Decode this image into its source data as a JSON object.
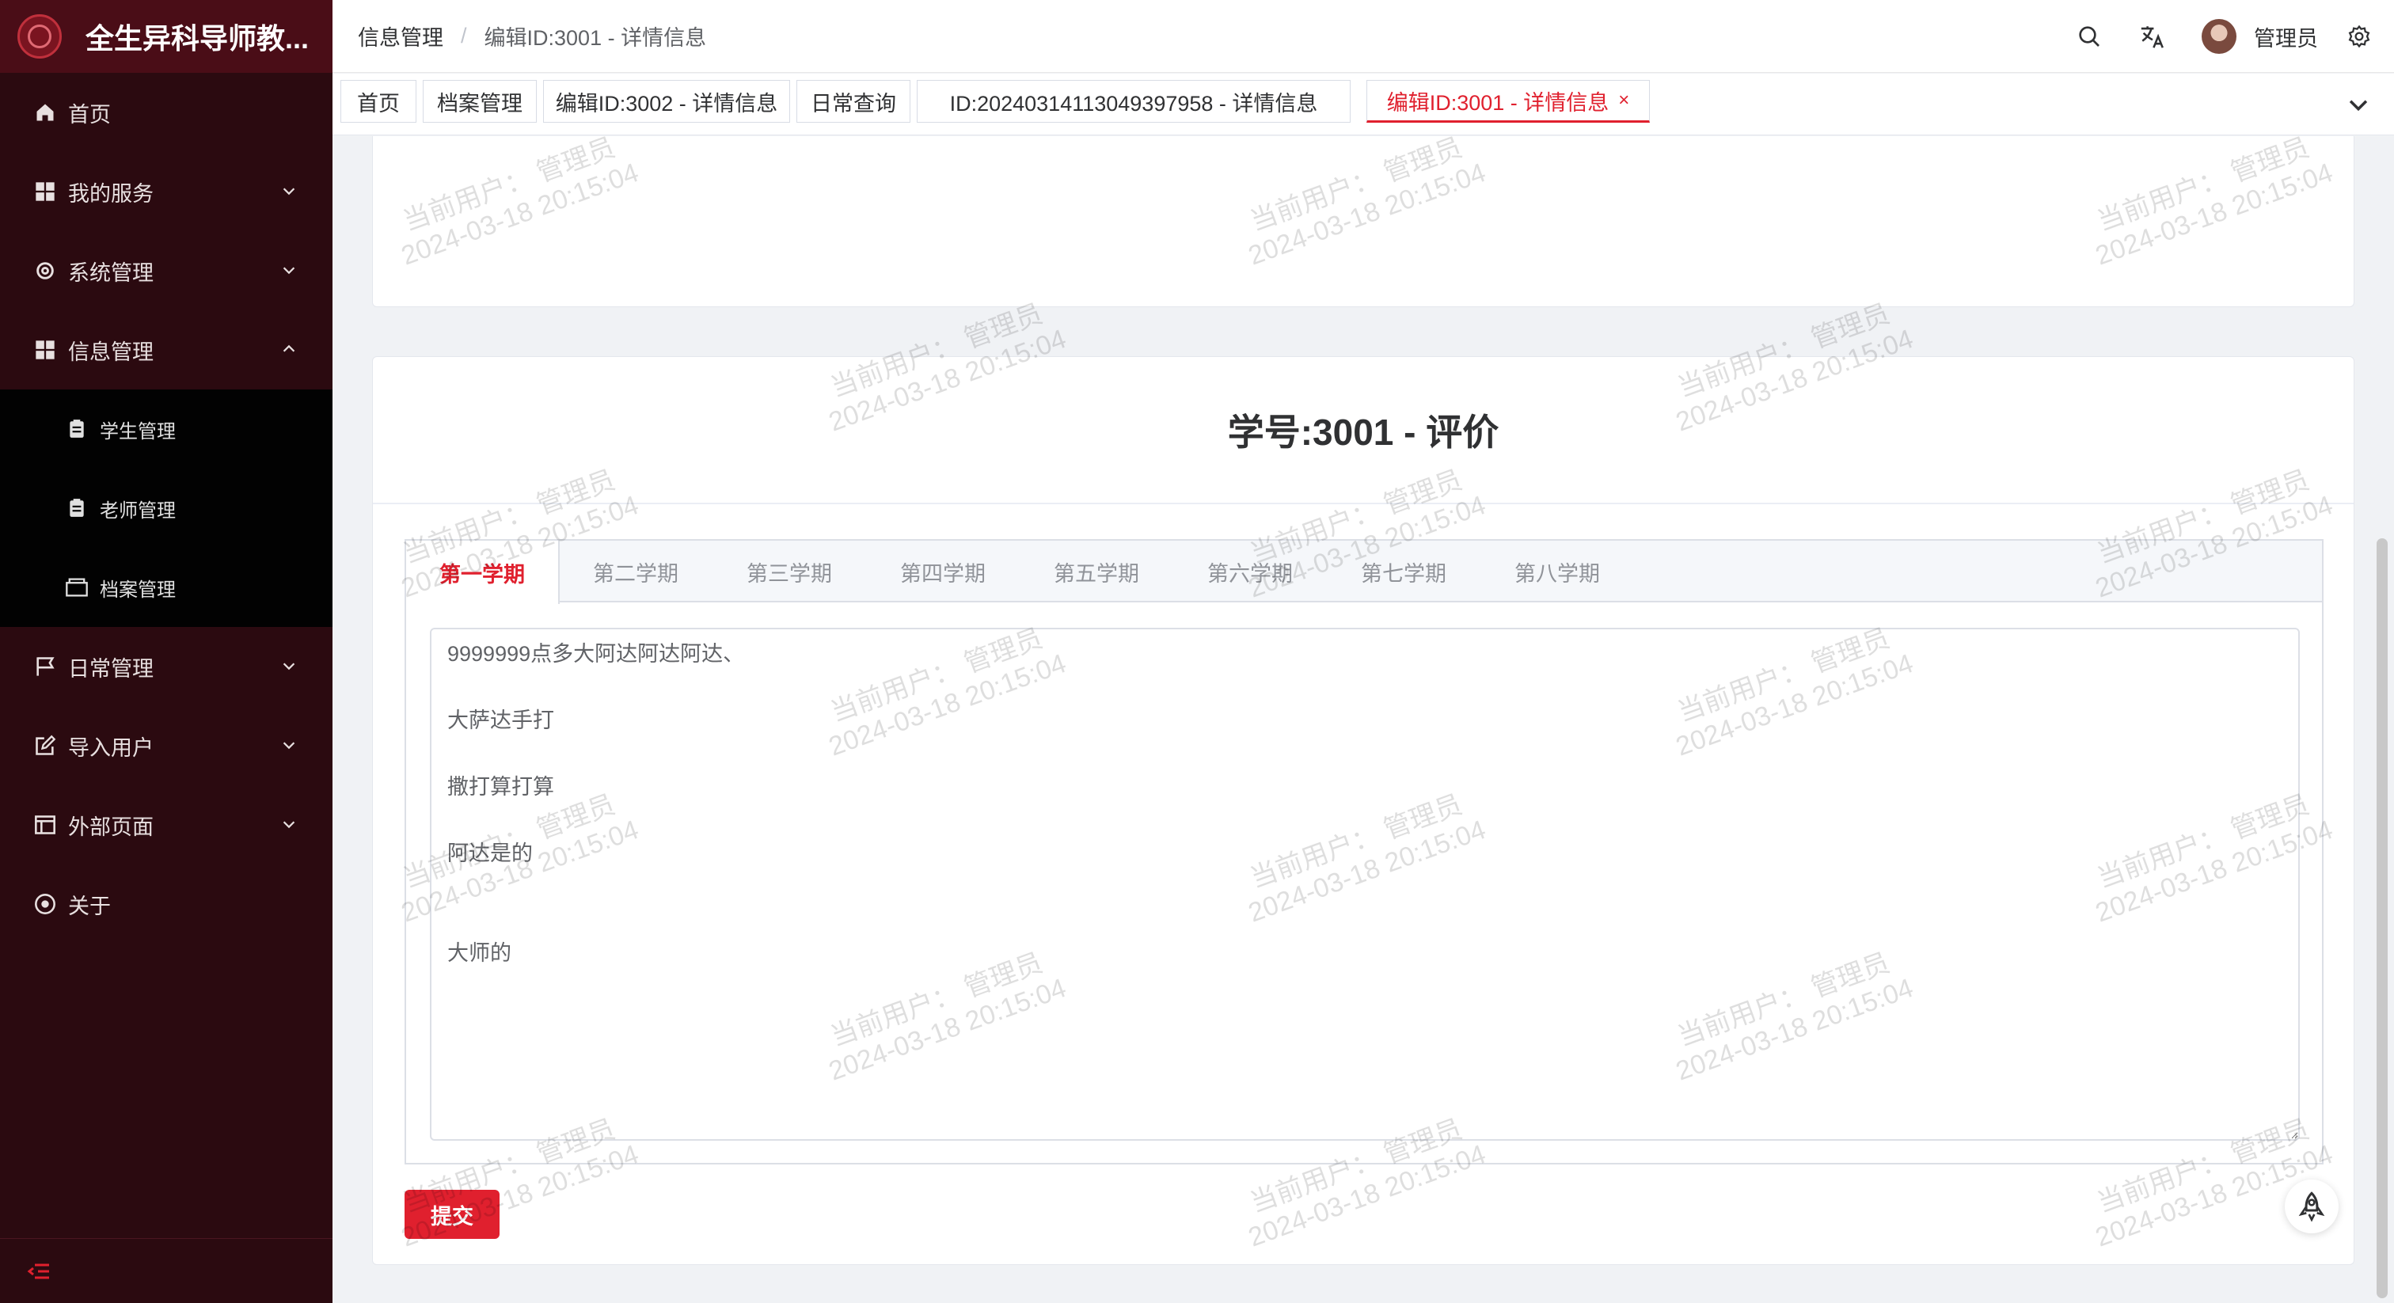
{
  "app": {
    "title": "全生异科导师教..."
  },
  "sidebar": {
    "items": [
      {
        "label": "首页",
        "icon": "home-icon"
      },
      {
        "label": "我的服务",
        "icon": "grid-icon"
      },
      {
        "label": "系统管理",
        "icon": "gear-icon"
      },
      {
        "label": "信息管理",
        "icon": "grid-icon",
        "expanded": true
      }
    ],
    "subitems": [
      {
        "label": "学生管理",
        "icon": "clipboard-icon"
      },
      {
        "label": "老师管理",
        "icon": "clipboard-icon"
      },
      {
        "label": "档案管理",
        "icon": "archive-icon"
      }
    ],
    "items_after": [
      {
        "label": "日常管理",
        "icon": "flag-icon"
      },
      {
        "label": "导入用户",
        "icon": "edit-icon"
      },
      {
        "label": "外部页面",
        "icon": "layout-icon"
      },
      {
        "label": "关于",
        "icon": "info-icon"
      }
    ]
  },
  "header": {
    "breadcrumb": [
      "信息管理",
      "编辑ID:3001 - 详情信息"
    ],
    "breadcrumb_sep": "/",
    "username": "管理员"
  },
  "tags": [
    {
      "label": "首页"
    },
    {
      "label": "档案管理"
    },
    {
      "label": "编辑ID:3002 - 详情信息"
    },
    {
      "label": "日常查询"
    },
    {
      "label": "ID:20240314113049397958 - 详情信息"
    },
    {
      "label": "编辑ID:3001 - 详情信息",
      "active": true,
      "close": "×"
    }
  ],
  "main": {
    "title": "学号:3001 - 评价",
    "tabs": [
      "第一学期",
      "第二学期",
      "第三学期",
      "第四学期",
      "第五学期",
      "第六学期",
      "第七学期",
      "第八学期"
    ],
    "active_tab": "第一学期",
    "evaluation_text": "9999999点多大阿达阿达阿达、\n\n大萨达手打\n\n撒打算打算\n\n阿达是的\n\n\n大师的",
    "submit_label": "提交"
  },
  "watermark": {
    "line1": "当前用户： 管理员",
    "line2": "2024-03-18 20:15:04"
  },
  "colors": {
    "accent": "#e0202e",
    "sidebar_bg": "#2b0a10",
    "logo_bar_bg": "#4a0d17",
    "submenu_bg": "#020202"
  }
}
